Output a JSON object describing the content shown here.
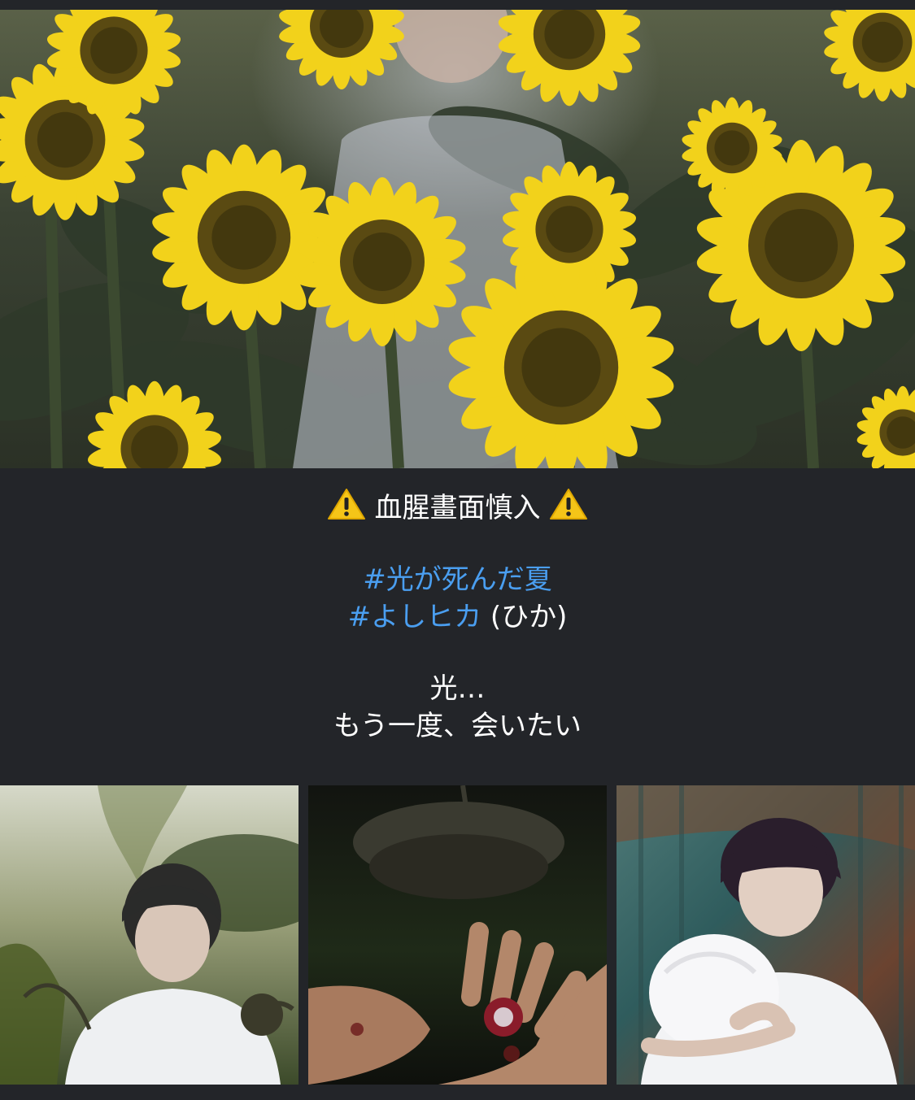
{
  "hero_image": {
    "icon": "sunflower-field-photo",
    "accent_color": "#f2d21b"
  },
  "caption": {
    "warning_icon": "warning-sign-icon",
    "warning_text": "血腥畫面慎入",
    "hashtags": [
      "#光が死んだ夏",
      "#よしヒカ"
    ],
    "hashtag_suffix": "(ひか)",
    "line1": "光…",
    "line2": "もう一度、会いたい",
    "text_color": "#ffffff",
    "hashtag_color": "#4a9ef0"
  },
  "thumbnails": [
    {
      "icon": "boy-with-wilted-sunflowers-photo"
    },
    {
      "icon": "hands-holding-bloody-heart-photo"
    },
    {
      "icon": "boy-hugging-white-haired-figure-photo"
    }
  ],
  "background_color": "#232529"
}
